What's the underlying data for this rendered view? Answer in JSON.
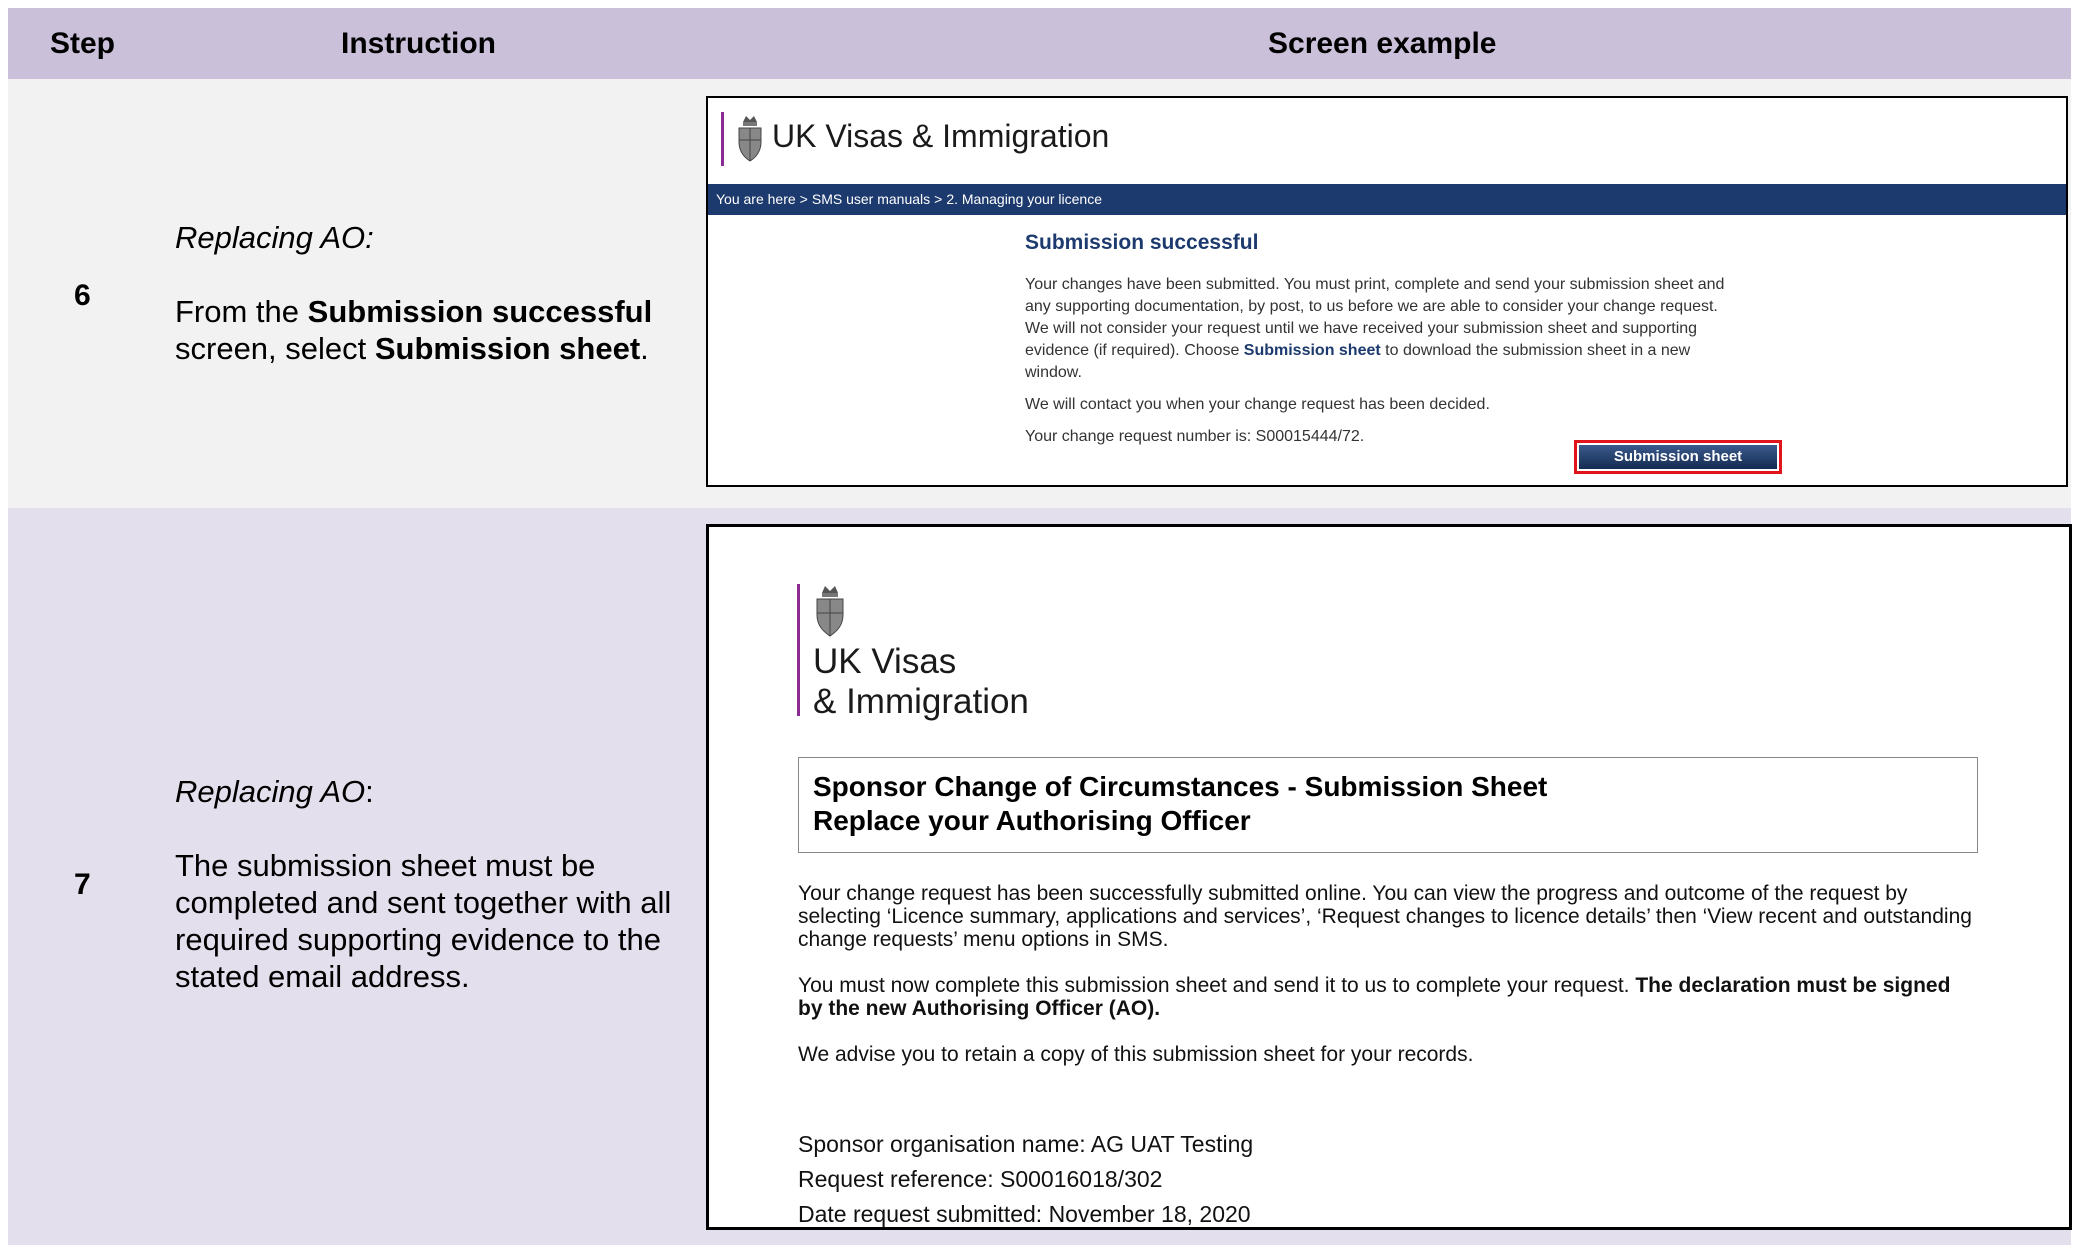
{
  "header": {
    "step": "Step",
    "instruction": "Instruction",
    "screen_example": "Screen example"
  },
  "rows": [
    {
      "step": "6",
      "heading": "Replacing AO:",
      "text_pre": "From the ",
      "bold1": "Submission successful",
      "text_mid": " screen, select ",
      "bold2": "Submission sheet",
      "text_post": ".",
      "screenshot": {
        "brand": "UK Visas & Immigration",
        "breadcrumb": [
          "You are here",
          "SMS user manuals",
          "2. Managing your licence"
        ],
        "breadcrumb_sep": ">",
        "title": "Submission successful",
        "para1_pre": "Your changes have been submitted. You must print, complete and send your submission sheet and any supporting documentation, by post, to us before we are able to consider your change request. We will not consider your request until we have received your submission sheet and supporting evidence (if required). Choose ",
        "para1_link": "Submission sheet",
        "para1_post": " to download the submission sheet in a new window.",
        "para2": "We will contact you when your change request has been decided.",
        "para3": "Your change request number is: S00015444/72.",
        "button": "Submission sheet",
        "colors": {
          "nav": "#1d3a6e",
          "highlight": "#e0151c",
          "accent": "#8a2b91"
        }
      }
    },
    {
      "step": "7",
      "heading": "Replacing AO",
      "heading_post": ":",
      "text": "The submission sheet must be completed and sent together with all required supporting evidence to the stated email address.",
      "screenshot": {
        "brand_line1": "UK Visas",
        "brand_line2": "& Immigration",
        "box_line1": "Sponsor Change of Circumstances - Submission Sheet",
        "box_line2": "Replace your Authorising Officer",
        "para1": "Your change request has been successfully submitted online. You can view the progress and outcome of the request by selecting ‘Licence summary, applications and services’, ‘Request changes to licence details’ then ‘View recent and outstanding change requests’ menu options in SMS.",
        "para2_pre": "You must now complete this submission sheet and send it to us to complete your request. ",
        "para2_bold": "The declaration must be signed by the new Authorising Officer (AO).",
        "para3": "We advise you to retain a copy of this submission sheet for your records.",
        "meta": [
          "Sponsor organisation name: AG UAT Testing",
          "Request reference: S00016018/302",
          "Date request submitted: November 18, 2020"
        ]
      }
    }
  ],
  "icons": {
    "crest": "royal-crest-icon"
  },
  "colors": {
    "header_bg": "#cbc0da",
    "row6_bg": "#f2f2f2",
    "row7_bg": "#e4dfec"
  }
}
